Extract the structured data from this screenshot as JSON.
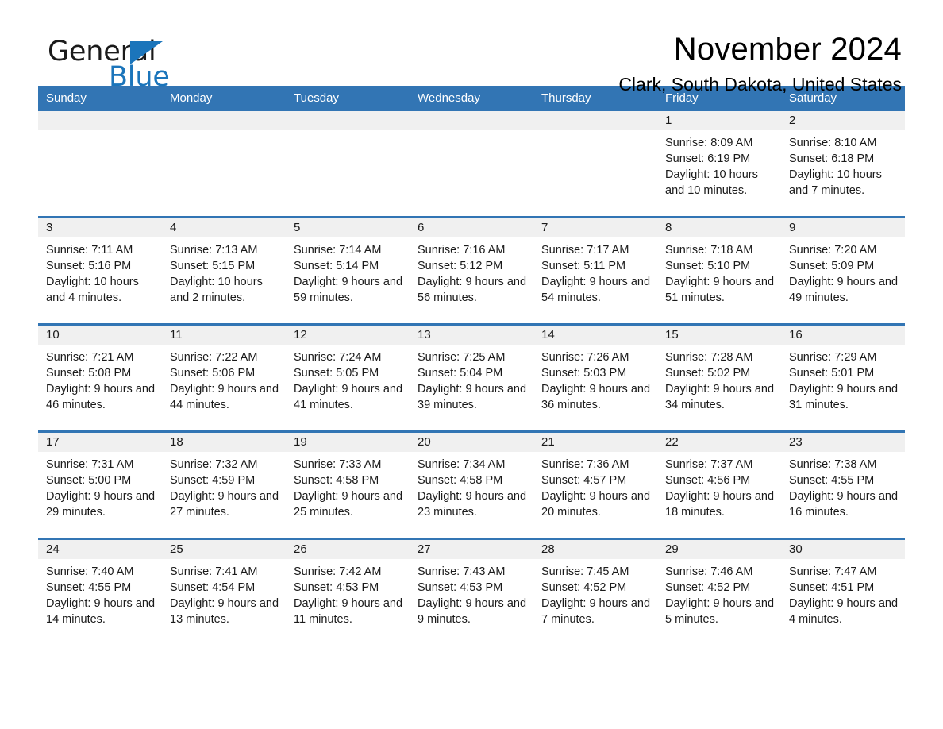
{
  "brand": {
    "name_part1": "General",
    "name_part2": "Blue",
    "triangle_icon": "blue-triangle-icon",
    "accent_color": "#1b75bb"
  },
  "header": {
    "title": "November 2024",
    "location": "Clark, South Dakota, United States"
  },
  "theme": {
    "header_blue": "#3275b4",
    "daynum_band": "#f0f0f0",
    "text": "#1a1a1a"
  },
  "calendar": {
    "weekday_headers": [
      "Sunday",
      "Monday",
      "Tuesday",
      "Wednesday",
      "Thursday",
      "Friday",
      "Saturday"
    ],
    "weeks": [
      [
        {
          "day": "",
          "sunrise": "",
          "sunset": "",
          "daylight": ""
        },
        {
          "day": "",
          "sunrise": "",
          "sunset": "",
          "daylight": ""
        },
        {
          "day": "",
          "sunrise": "",
          "sunset": "",
          "daylight": ""
        },
        {
          "day": "",
          "sunrise": "",
          "sunset": "",
          "daylight": ""
        },
        {
          "day": "",
          "sunrise": "",
          "sunset": "",
          "daylight": ""
        },
        {
          "day": "1",
          "sunrise": "Sunrise: 8:09 AM",
          "sunset": "Sunset: 6:19 PM",
          "daylight": "Daylight: 10 hours and 10 minutes."
        },
        {
          "day": "2",
          "sunrise": "Sunrise: 8:10 AM",
          "sunset": "Sunset: 6:18 PM",
          "daylight": "Daylight: 10 hours and 7 minutes."
        }
      ],
      [
        {
          "day": "3",
          "sunrise": "Sunrise: 7:11 AM",
          "sunset": "Sunset: 5:16 PM",
          "daylight": "Daylight: 10 hours and 4 minutes."
        },
        {
          "day": "4",
          "sunrise": "Sunrise: 7:13 AM",
          "sunset": "Sunset: 5:15 PM",
          "daylight": "Daylight: 10 hours and 2 minutes."
        },
        {
          "day": "5",
          "sunrise": "Sunrise: 7:14 AM",
          "sunset": "Sunset: 5:14 PM",
          "daylight": "Daylight: 9 hours and 59 minutes."
        },
        {
          "day": "6",
          "sunrise": "Sunrise: 7:16 AM",
          "sunset": "Sunset: 5:12 PM",
          "daylight": "Daylight: 9 hours and 56 minutes."
        },
        {
          "day": "7",
          "sunrise": "Sunrise: 7:17 AM",
          "sunset": "Sunset: 5:11 PM",
          "daylight": "Daylight: 9 hours and 54 minutes."
        },
        {
          "day": "8",
          "sunrise": "Sunrise: 7:18 AM",
          "sunset": "Sunset: 5:10 PM",
          "daylight": "Daylight: 9 hours and 51 minutes."
        },
        {
          "day": "9",
          "sunrise": "Sunrise: 7:20 AM",
          "sunset": "Sunset: 5:09 PM",
          "daylight": "Daylight: 9 hours and 49 minutes."
        }
      ],
      [
        {
          "day": "10",
          "sunrise": "Sunrise: 7:21 AM",
          "sunset": "Sunset: 5:08 PM",
          "daylight": "Daylight: 9 hours and 46 minutes."
        },
        {
          "day": "11",
          "sunrise": "Sunrise: 7:22 AM",
          "sunset": "Sunset: 5:06 PM",
          "daylight": "Daylight: 9 hours and 44 minutes."
        },
        {
          "day": "12",
          "sunrise": "Sunrise: 7:24 AM",
          "sunset": "Sunset: 5:05 PM",
          "daylight": "Daylight: 9 hours and 41 minutes."
        },
        {
          "day": "13",
          "sunrise": "Sunrise: 7:25 AM",
          "sunset": "Sunset: 5:04 PM",
          "daylight": "Daylight: 9 hours and 39 minutes."
        },
        {
          "day": "14",
          "sunrise": "Sunrise: 7:26 AM",
          "sunset": "Sunset: 5:03 PM",
          "daylight": "Daylight: 9 hours and 36 minutes."
        },
        {
          "day": "15",
          "sunrise": "Sunrise: 7:28 AM",
          "sunset": "Sunset: 5:02 PM",
          "daylight": "Daylight: 9 hours and 34 minutes."
        },
        {
          "day": "16",
          "sunrise": "Sunrise: 7:29 AM",
          "sunset": "Sunset: 5:01 PM",
          "daylight": "Daylight: 9 hours and 31 minutes."
        }
      ],
      [
        {
          "day": "17",
          "sunrise": "Sunrise: 7:31 AM",
          "sunset": "Sunset: 5:00 PM",
          "daylight": "Daylight: 9 hours and 29 minutes."
        },
        {
          "day": "18",
          "sunrise": "Sunrise: 7:32 AM",
          "sunset": "Sunset: 4:59 PM",
          "daylight": "Daylight: 9 hours and 27 minutes."
        },
        {
          "day": "19",
          "sunrise": "Sunrise: 7:33 AM",
          "sunset": "Sunset: 4:58 PM",
          "daylight": "Daylight: 9 hours and 25 minutes."
        },
        {
          "day": "20",
          "sunrise": "Sunrise: 7:34 AM",
          "sunset": "Sunset: 4:58 PM",
          "daylight": "Daylight: 9 hours and 23 minutes."
        },
        {
          "day": "21",
          "sunrise": "Sunrise: 7:36 AM",
          "sunset": "Sunset: 4:57 PM",
          "daylight": "Daylight: 9 hours and 20 minutes."
        },
        {
          "day": "22",
          "sunrise": "Sunrise: 7:37 AM",
          "sunset": "Sunset: 4:56 PM",
          "daylight": "Daylight: 9 hours and 18 minutes."
        },
        {
          "day": "23",
          "sunrise": "Sunrise: 7:38 AM",
          "sunset": "Sunset: 4:55 PM",
          "daylight": "Daylight: 9 hours and 16 minutes."
        }
      ],
      [
        {
          "day": "24",
          "sunrise": "Sunrise: 7:40 AM",
          "sunset": "Sunset: 4:55 PM",
          "daylight": "Daylight: 9 hours and 14 minutes."
        },
        {
          "day": "25",
          "sunrise": "Sunrise: 7:41 AM",
          "sunset": "Sunset: 4:54 PM",
          "daylight": "Daylight: 9 hours and 13 minutes."
        },
        {
          "day": "26",
          "sunrise": "Sunrise: 7:42 AM",
          "sunset": "Sunset: 4:53 PM",
          "daylight": "Daylight: 9 hours and 11 minutes."
        },
        {
          "day": "27",
          "sunrise": "Sunrise: 7:43 AM",
          "sunset": "Sunset: 4:53 PM",
          "daylight": "Daylight: 9 hours and 9 minutes."
        },
        {
          "day": "28",
          "sunrise": "Sunrise: 7:45 AM",
          "sunset": "Sunset: 4:52 PM",
          "daylight": "Daylight: 9 hours and 7 minutes."
        },
        {
          "day": "29",
          "sunrise": "Sunrise: 7:46 AM",
          "sunset": "Sunset: 4:52 PM",
          "daylight": "Daylight: 9 hours and 5 minutes."
        },
        {
          "day": "30",
          "sunrise": "Sunrise: 7:47 AM",
          "sunset": "Sunset: 4:51 PM",
          "daylight": "Daylight: 9 hours and 4 minutes."
        }
      ]
    ]
  }
}
